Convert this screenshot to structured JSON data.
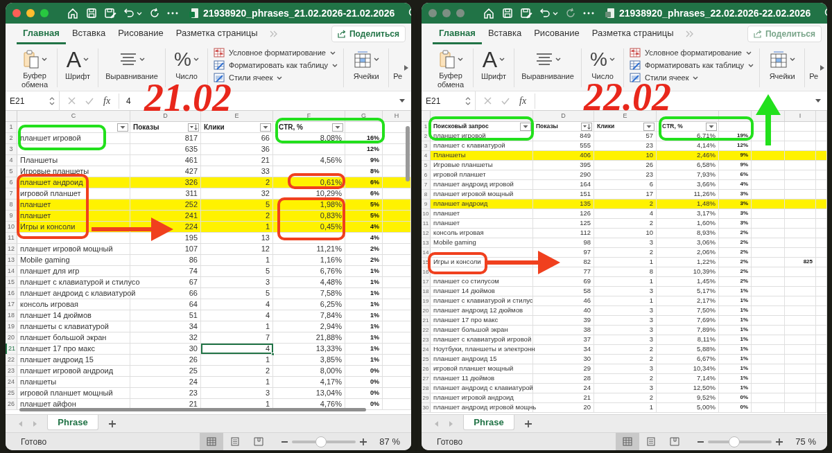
{
  "windows": [
    {
      "active": true,
      "title": "21938920_phrases_21.02.2026-21.02.2026",
      "stamp": "21.02",
      "ribbon_tabs": [
        {
          "label": "Главная",
          "selected": true
        },
        {
          "label": "Вставка",
          "selected": false
        },
        {
          "label": "Рисование",
          "selected": false
        },
        {
          "label": "Разметка страницы",
          "selected": false
        }
      ],
      "share_button": "Поделиться",
      "ribbon_groups": [
        {
          "kind": "clipboard",
          "label": "Буфер обмена"
        },
        {
          "kind": "font",
          "glyph": "A",
          "label": "Шрифт"
        },
        {
          "kind": "alignment",
          "label": "Выравнивание"
        },
        {
          "kind": "number",
          "glyph": "%",
          "label": "Число"
        },
        {
          "kind": "styles",
          "items": [
            "Условное форматирование",
            "Форматировать как таблицу",
            "Стили ячеек"
          ]
        },
        {
          "kind": "cells",
          "label": "Ячейки"
        },
        {
          "kind": "cut",
          "label": "Ре"
        }
      ],
      "name_box": "E21",
      "function_button": "fx",
      "formula": "4",
      "columns": [
        {
          "kind": "lettered",
          "letter": "C"
        },
        {
          "kind": "lettered",
          "letter": "D"
        },
        {
          "kind": "lettered",
          "letter": "E"
        },
        {
          "kind": "lettered",
          "letter": "F"
        },
        {
          "kind": "lettered",
          "letter": "G"
        },
        {
          "kind": "lettered",
          "letter": "H"
        }
      ],
      "rows": [
        {
          "n": "1",
          "kind": "header",
          "cells": [
            {
              "kind": "filter"
            },
            {
              "text": "Показы",
              "kind": "sort"
            },
            {
              "text": "Клики",
              "kind": "filter"
            },
            {
              "text": "CTR, %",
              "kind": "filter"
            }
          ]
        },
        {
          "n": "2",
          "highlighted": false,
          "cells": [
            "планшет игровой",
            "817",
            "66",
            "8,08%",
            "16%"
          ]
        },
        {
          "n": "3",
          "highlighted": false,
          "cells": [
            null,
            "635",
            "36",
            null,
            "12%"
          ]
        },
        {
          "n": "4",
          "highlighted": false,
          "cells": [
            "Планшеты",
            "461",
            "21",
            "4,56%",
            "9%"
          ]
        },
        {
          "n": "5",
          "highlighted": false,
          "cells": [
            "Игровые планшеты",
            "427",
            "33",
            null,
            "8%"
          ]
        },
        {
          "n": "6",
          "highlighted": true,
          "cells": [
            "планшет андроид",
            "326",
            "2",
            "0,61%",
            "6%"
          ]
        },
        {
          "n": "7",
          "highlighted": false,
          "cells": [
            "игровой планшет",
            "311",
            "32",
            "10,29%",
            "6%"
          ]
        },
        {
          "n": "8",
          "highlighted": true,
          "cells": [
            "планшет",
            "252",
            "5",
            "1,98%",
            "5%"
          ]
        },
        {
          "n": "9",
          "highlighted": true,
          "cells": [
            "планшет",
            "241",
            "2",
            "0,83%",
            "5%"
          ]
        },
        {
          "n": "10",
          "highlighted": true,
          "cells": [
            "Игры и консоли",
            "224",
            "1",
            "0,45%",
            "4%"
          ]
        },
        {
          "n": "11",
          "highlighted": false,
          "cells": [
            null,
            "195",
            "13",
            null,
            "4%"
          ]
        },
        {
          "n": "12",
          "highlighted": false,
          "cells": [
            "планшет игровой мощный",
            "107",
            "12",
            "11,21%",
            "2%"
          ]
        },
        {
          "n": "13",
          "highlighted": false,
          "cells": [
            "Mobile gaming",
            "86",
            "1",
            "1,16%",
            "2%"
          ]
        },
        {
          "n": "14",
          "highlighted": false,
          "cells": [
            "планшет для игр",
            "74",
            "5",
            "6,76%",
            "1%"
          ]
        },
        {
          "n": "15",
          "highlighted": false,
          "cells": [
            "планшет с клавиатурой и стилусо",
            "67",
            "3",
            "4,48%",
            "1%"
          ]
        },
        {
          "n": "16",
          "highlighted": false,
          "cells": [
            "планшет андроид с клавиатурой",
            "66",
            "5",
            "7,58%",
            "1%"
          ]
        },
        {
          "n": "17",
          "highlighted": false,
          "cells": [
            "консоль игровая",
            "64",
            "4",
            "6,25%",
            "1%"
          ]
        },
        {
          "n": "18",
          "highlighted": false,
          "cells": [
            "планшет 14 дюймов",
            "51",
            "4",
            "7,84%",
            "1%"
          ]
        },
        {
          "n": "19",
          "highlighted": false,
          "cells": [
            "планшеты с клавиатурой",
            "34",
            "1",
            "2,94%",
            "1%"
          ]
        },
        {
          "n": "20",
          "highlighted": false,
          "cells": [
            "планшет большой экран",
            "32",
            "7",
            "21,88%",
            "1%"
          ]
        },
        {
          "n": "21",
          "highlighted": false,
          "cells": [
            "планшет 17 про макс",
            "30",
            {
              "text": "4",
              "selected": true
            },
            "13,33%",
            "1%"
          ]
        },
        {
          "n": "22",
          "highlighted": false,
          "cells": [
            "планшет андроид 15",
            "26",
            "1",
            "3,85%",
            "1%"
          ]
        },
        {
          "n": "23",
          "highlighted": false,
          "cells": [
            "планшет игровой андроид",
            "25",
            "2",
            "8,00%",
            "0%"
          ]
        },
        {
          "n": "24",
          "highlighted": false,
          "cells": [
            "планшеты",
            "24",
            "1",
            "4,17%",
            "0%"
          ]
        },
        {
          "n": "25",
          "highlighted": false,
          "cells": [
            "игровой планшет мощный",
            "23",
            "3",
            "13,04%",
            "0%"
          ]
        },
        {
          "n": "26",
          "highlighted": false,
          "cells": [
            "планшет айфон",
            "21",
            "1",
            "4,76%",
            "0%"
          ]
        }
      ],
      "sheet_tabs": [
        {
          "label": "Phrase",
          "selected": true
        }
      ],
      "status": "Готово",
      "views": [
        {
          "kind": "normal",
          "selected": true
        },
        {
          "kind": "page_layout",
          "selected": false
        },
        {
          "kind": "page_break",
          "selected": false
        }
      ],
      "zoom": {
        "level": 0.45,
        "reading": "87 %"
      }
    },
    {
      "active": false,
      "title": "21938920_phrases_22.02.2026-22.02.2026",
      "stamp": "22.02",
      "ribbon_tabs": [
        {
          "label": "Главная",
          "selected": true
        },
        {
          "label": "Вставка",
          "selected": false
        },
        {
          "label": "Рисование",
          "selected": false
        },
        {
          "label": "Разметка страницы",
          "selected": false
        }
      ],
      "share_button": "Поделиться",
      "ribbon_groups": [
        {
          "kind": "clipboard",
          "label": "Буфер обмена"
        },
        {
          "kind": "font",
          "glyph": "A",
          "label": "Шрифт"
        },
        {
          "kind": "alignment",
          "label": "Выравнивание"
        },
        {
          "kind": "number",
          "glyph": "%",
          "label": "Число"
        },
        {
          "kind": "styles",
          "items": [
            "Условное форматирование",
            "Форматировать как таблицу",
            "Стили ячеек"
          ]
        },
        {
          "kind": "cells",
          "label": "Ячейки"
        },
        {
          "kind": "cut",
          "label": "Ре"
        }
      ],
      "name_box": "E21",
      "function_button": "fx",
      "columns": [
        {
          "kind": "blank"
        },
        {
          "kind": "lettered",
          "letter": "D"
        },
        {
          "kind": "lettered",
          "letter": "E"
        },
        {
          "kind": "blank"
        },
        {
          "kind": "blank"
        },
        {
          "kind": "blank"
        },
        {
          "kind": "lettered",
          "letter": "I"
        },
        {
          "kind": "blank"
        }
      ],
      "rows": [
        {
          "n": "1",
          "kind": "header",
          "cells": [
            {
              "text": "Поисковый запрос",
              "kind": "filter"
            },
            {
              "text": "Показы",
              "kind": "sort"
            },
            {
              "text": "Клики",
              "kind": "filter"
            },
            {
              "text": "CTR, %",
              "kind": "filter"
            }
          ]
        },
        {
          "n": "2",
          "highlighted": false,
          "cells": [
            "планшет игровой",
            "849",
            "57",
            "6,71%",
            "19%"
          ]
        },
        {
          "n": "3",
          "highlighted": false,
          "cells": [
            "планшет с клавиатурой",
            "555",
            "23",
            "4,14%",
            "12%"
          ]
        },
        {
          "n": "4",
          "highlighted": true,
          "cells": [
            "Планшеты",
            "406",
            "10",
            "2,46%",
            "9%"
          ]
        },
        {
          "n": "5",
          "highlighted": false,
          "cells": [
            "Игровые планшеты",
            "395",
            "26",
            "6,58%",
            "9%"
          ]
        },
        {
          "n": "6",
          "highlighted": false,
          "cells": [
            "игровой планшет",
            "290",
            "23",
            "7,93%",
            "6%"
          ]
        },
        {
          "n": "7",
          "highlighted": false,
          "cells": [
            "планшет андроид игровой",
            "164",
            "6",
            "3,66%",
            "4%"
          ]
        },
        {
          "n": "8",
          "highlighted": false,
          "cells": [
            "планшет игровой мощный",
            "151",
            "17",
            "11,26%",
            "3%"
          ]
        },
        {
          "n": "9",
          "highlighted": true,
          "cells": [
            "планшет андроид",
            "135",
            "2",
            "1,48%",
            "3%"
          ]
        },
        {
          "n": "10",
          "highlighted": false,
          "cells": [
            "планшет",
            "126",
            "4",
            "3,17%",
            "3%"
          ]
        },
        {
          "n": "11",
          "highlighted": false,
          "cells": [
            "планшет",
            "125",
            "2",
            "1,60%",
            "3%"
          ]
        },
        {
          "n": "12",
          "highlighted": false,
          "cells": [
            "консоль игровая",
            "112",
            "10",
            "8,93%",
            "2%"
          ]
        },
        {
          "n": "13",
          "highlighted": false,
          "cells": [
            "Mobile gaming",
            "98",
            "3",
            "3,06%",
            "2%"
          ]
        },
        {
          "n": "14",
          "highlighted": false,
          "cells": [
            null,
            "97",
            "2",
            "2,06%",
            "2%"
          ]
        },
        {
          "n": "15",
          "highlighted": false,
          "cells": [
            "Игры и консоли",
            "82",
            "1",
            "1,22%",
            "2%",
            null,
            "825"
          ]
        },
        {
          "n": "16",
          "highlighted": false,
          "cells": [
            null,
            "77",
            "8",
            "10,39%",
            "2%"
          ]
        },
        {
          "n": "17",
          "highlighted": false,
          "cells": [
            "планшет со стилусом",
            "69",
            "1",
            "1,45%",
            "2%"
          ]
        },
        {
          "n": "18",
          "highlighted": false,
          "cells": [
            "планшет 14 дюймов",
            "58",
            "3",
            "5,17%",
            "1%"
          ]
        },
        {
          "n": "19",
          "highlighted": false,
          "cells": [
            "планшет с клавиатурой и стилус",
            "46",
            "1",
            "2,17%",
            "1%"
          ]
        },
        {
          "n": "20",
          "highlighted": false,
          "cells": [
            "планшет андроид 12 дюймов",
            "40",
            "3",
            "7,50%",
            "1%"
          ]
        },
        {
          "n": "21",
          "highlighted": false,
          "cells": [
            "планшет 17 про макс",
            "39",
            "3",
            "7,69%",
            "1%"
          ]
        },
        {
          "n": "22",
          "highlighted": false,
          "cells": [
            "планшет большой экран",
            "38",
            "3",
            "7,89%",
            "1%"
          ]
        },
        {
          "n": "23",
          "highlighted": false,
          "cells": [
            "планшет с клавиатурой игровой",
            "37",
            "3",
            "8,11%",
            "1%"
          ]
        },
        {
          "n": "24",
          "highlighted": false,
          "cells": [
            "Ноутбуки, планшеты и электронн",
            "34",
            "2",
            "5,88%",
            "1%"
          ]
        },
        {
          "n": "25",
          "highlighted": false,
          "cells": [
            "планшет андроид 15",
            "30",
            "2",
            "6,67%",
            "1%"
          ]
        },
        {
          "n": "26",
          "highlighted": false,
          "cells": [
            "игровой планшет мощный",
            "29",
            "3",
            "10,34%",
            "1%"
          ]
        },
        {
          "n": "27",
          "highlighted": false,
          "cells": [
            "планшет 11 дюймов",
            "28",
            "2",
            "7,14%",
            "1%"
          ]
        },
        {
          "n": "28",
          "highlighted": false,
          "cells": [
            "планшет андроид с клавиатурой",
            "24",
            "3",
            "12,50%",
            "1%"
          ]
        },
        {
          "n": "29",
          "highlighted": false,
          "cells": [
            "планшет игровой андроид",
            "21",
            "2",
            "9,52%",
            "0%"
          ]
        },
        {
          "n": "30",
          "highlighted": false,
          "cells": [
            "планшет андроид игровой мощнь",
            "20",
            "1",
            "5,00%",
            "0%"
          ]
        }
      ],
      "sheet_tabs": [
        {
          "label": "Phrase",
          "selected": true
        }
      ],
      "status": "Готово",
      "views": [
        {
          "kind": "normal",
          "selected": true
        },
        {
          "kind": "page_layout",
          "selected": false
        },
        {
          "kind": "page_break",
          "selected": false
        }
      ],
      "zoom": {
        "level": 0.4,
        "reading": "75 %"
      }
    }
  ]
}
